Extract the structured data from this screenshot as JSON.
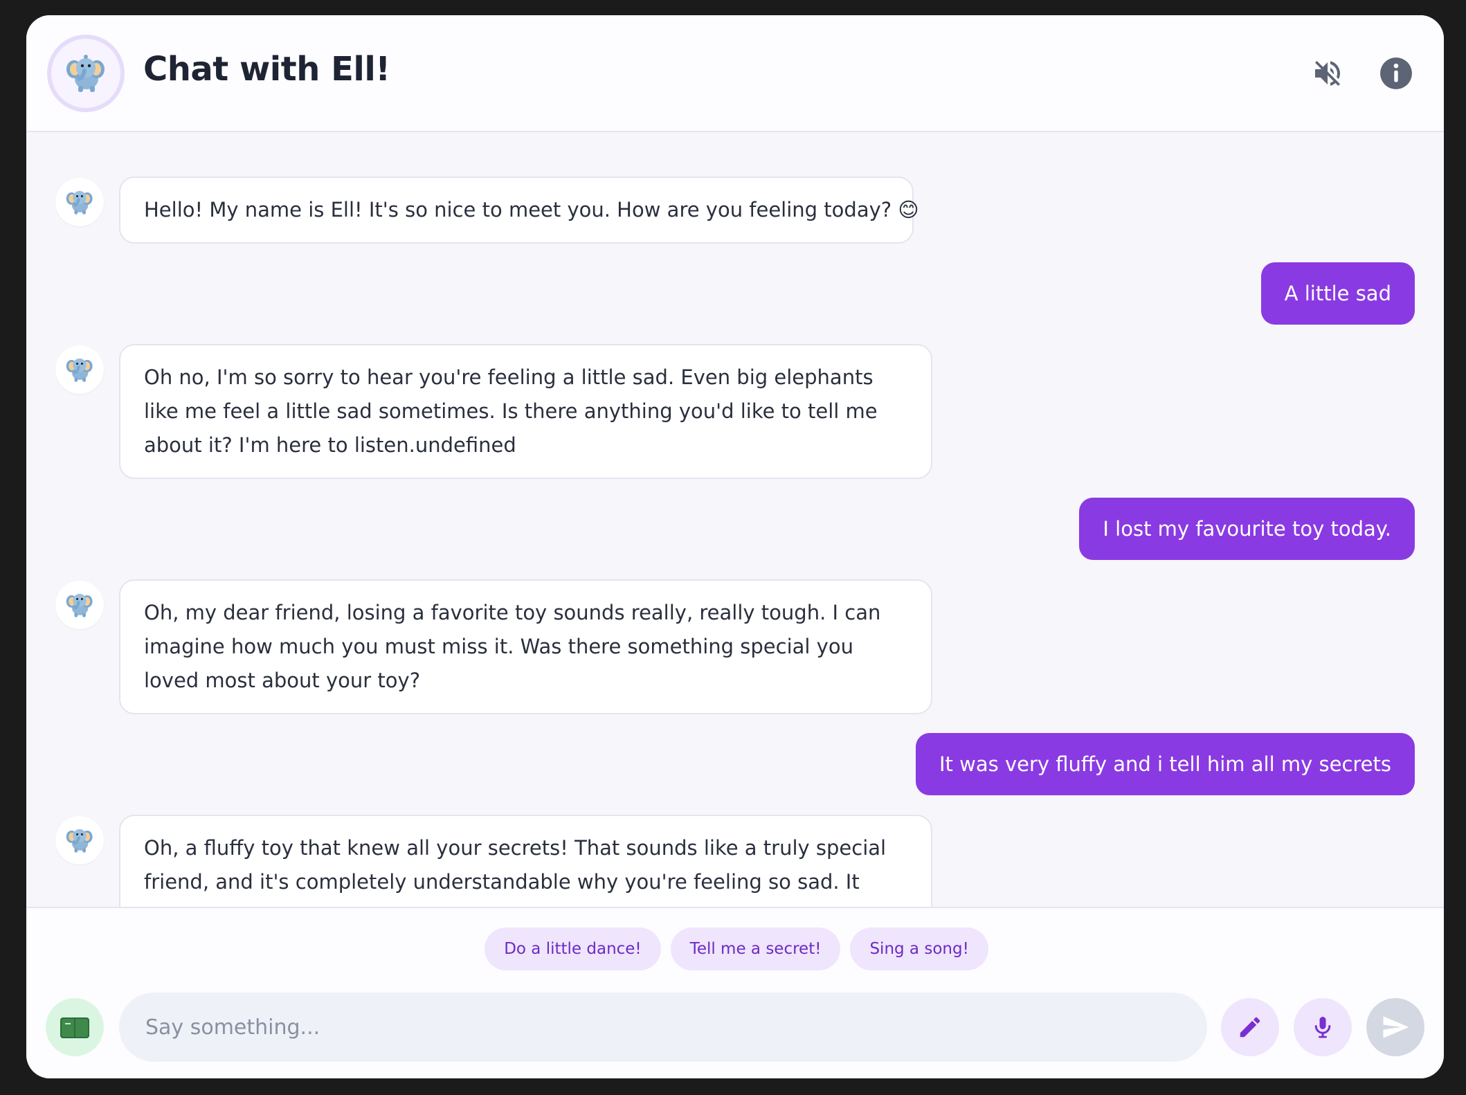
{
  "header": {
    "title": "Chat with Ell!",
    "avatar_icon": "elephant-icon",
    "mute_icon": "speaker-muted-icon",
    "info_icon": "info-icon"
  },
  "messages": [
    {
      "from": "bot",
      "text": "Hello! My name is Ell! It's so nice to meet you. How are you feeling today? 😊"
    },
    {
      "from": "user",
      "text": "A little sad"
    },
    {
      "from": "bot",
      "text": "Oh no, I'm so sorry to hear you're feeling a little sad. Even big elephants like me feel a little sad sometimes. Is there anything you'd like to tell me about it? I'm here to listen.undefined"
    },
    {
      "from": "user",
      "text": "I lost my favourite toy today."
    },
    {
      "from": "bot",
      "text": "Oh, my dear friend, losing a favorite toy sounds really, really tough. I can imagine how much you must miss it. Was there something special you loved most about your toy?"
    },
    {
      "from": "user",
      "text": "It was very fluffy and i tell him all my secrets"
    },
    {
      "from": "bot",
      "text": "Oh, a fluffy toy that knew all your secrets! That sounds like a truly special friend, and it's completely understandable why you're feeling so sad. It must have been wonderful to have someone so soft and trustworthy to talk to. Do"
    }
  ],
  "suggestions": [
    "Do a little dance!",
    "Tell me a secret!",
    "Sing a song!"
  ],
  "composer": {
    "placeholder": "Say something...",
    "book_icon": "book-icon",
    "pencil_icon": "pencil-icon",
    "mic_icon": "microphone-icon",
    "send_icon": "send-icon"
  },
  "colors": {
    "accent": "#8a3ae2",
    "chip_bg": "#efe5fc",
    "chip_text": "#6c2bc4",
    "book_bg": "#daf6e2",
    "send_disabled": "#d3d8e2"
  }
}
